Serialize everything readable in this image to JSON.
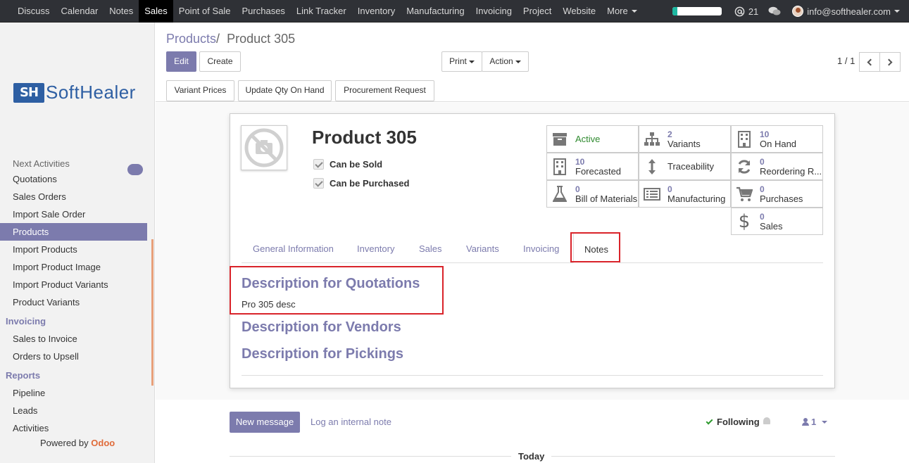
{
  "topnav": {
    "items": [
      "Discuss",
      "Calendar",
      "Notes",
      "Sales",
      "Point of Sale",
      "Purchases",
      "Link Tracker",
      "Inventory",
      "Manufacturing",
      "Invoicing",
      "Project",
      "Website",
      "More"
    ],
    "active": "Sales",
    "progress": 0.1,
    "activity_count": "21",
    "user_email": "info@softhealer.com"
  },
  "sidebar": {
    "logo_mark": "SH",
    "logo_text": "SoftHealer",
    "partial_top": "Next Activities",
    "sales_items": [
      "Quotations",
      "Sales Orders",
      "Import Sale Order",
      "Products",
      "Import Products",
      "Import Product Image",
      "Import Product Variants",
      "Product Variants"
    ],
    "active_item": "Products",
    "invoicing_header": "Invoicing",
    "invoicing_items": [
      "Sales to Invoice",
      "Orders to Upsell"
    ],
    "reports_header": "Reports",
    "reports_items": [
      "Pipeline",
      "Leads",
      "Activities"
    ],
    "powered_prefix": "Powered by",
    "powered_brand": "Odoo"
  },
  "control": {
    "breadcrumb_parent": "Products",
    "breadcrumb_sep": "/",
    "breadcrumb_current": "Product 305",
    "edit": "Edit",
    "create": "Create",
    "print": "Print",
    "action": "Action",
    "pager": "1 / 1",
    "header_buttons": [
      "Variant Prices",
      "Update Qty On Hand",
      "Procurement Request"
    ]
  },
  "product": {
    "name": "Product 305",
    "can_be_sold": "Can be Sold",
    "can_be_purchased": "Can be Purchased"
  },
  "stats": {
    "active": {
      "label": "Active"
    },
    "variants": {
      "num": "2",
      "label": "Variants"
    },
    "on_hand": {
      "num": "10",
      "label": "On Hand"
    },
    "forecasted": {
      "num": "10",
      "label": "Forecasted"
    },
    "traceability": {
      "label": "Traceability"
    },
    "reordering": {
      "num": "0",
      "label": "Reordering R..."
    },
    "bom": {
      "num": "0",
      "label": "Bill of Materials"
    },
    "manufacturing": {
      "num": "0",
      "label": "Manufacturing"
    },
    "purchases": {
      "num": "0",
      "label": "Purchases"
    },
    "sales": {
      "num": "0",
      "label": "Sales"
    }
  },
  "tabs": [
    "General Information",
    "Inventory",
    "Sales",
    "Variants",
    "Invoicing",
    "Notes"
  ],
  "active_tab": "Notes",
  "notes": {
    "quotations_title": "Description for Quotations",
    "quotations_text": "Pro 305 desc",
    "vendors_title": "Description for Vendors",
    "pickings_title": "Description for Pickings"
  },
  "chatter": {
    "new_message": "New message",
    "log_note": "Log an internal note",
    "following": "Following",
    "followers_count": "1",
    "today": "Today"
  },
  "colors": {
    "accent": "#7c7bad",
    "highlight": "#d9232a",
    "navbar": "#2f3136"
  }
}
